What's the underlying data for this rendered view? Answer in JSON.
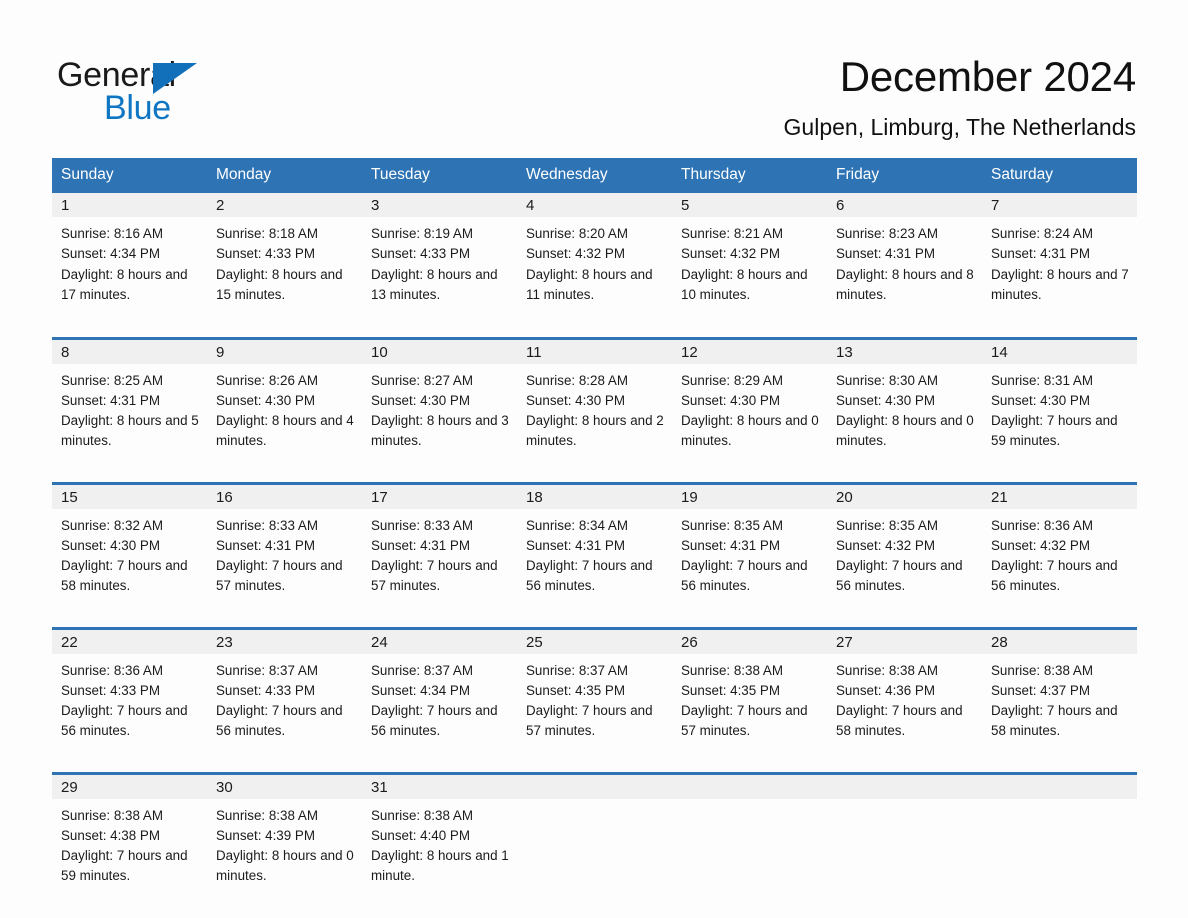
{
  "brand": {
    "name_part1": "General",
    "name_part2": "Blue",
    "triangle_color": "#1270ba",
    "blue_text_color": "#0f76c3"
  },
  "header": {
    "title": "December 2024",
    "subtitle": "Gulpen, Limburg, The Netherlands"
  },
  "theme": {
    "header_blue": "#2e74b5",
    "day_band_gray": "#f0f0f0",
    "page_background": "#fdfdfd",
    "text_color": "#1b1b1b"
  },
  "weekday_headers": [
    "Sunday",
    "Monday",
    "Tuesday",
    "Wednesday",
    "Thursday",
    "Friday",
    "Saturday"
  ],
  "weeks": [
    [
      {
        "day": "1",
        "sunrise": "Sunrise: 8:16 AM",
        "sunset": "Sunset: 4:34 PM",
        "daylight": "Daylight: 8 hours and 17 minutes."
      },
      {
        "day": "2",
        "sunrise": "Sunrise: 8:18 AM",
        "sunset": "Sunset: 4:33 PM",
        "daylight": "Daylight: 8 hours and 15 minutes."
      },
      {
        "day": "3",
        "sunrise": "Sunrise: 8:19 AM",
        "sunset": "Sunset: 4:33 PM",
        "daylight": "Daylight: 8 hours and 13 minutes."
      },
      {
        "day": "4",
        "sunrise": "Sunrise: 8:20 AM",
        "sunset": "Sunset: 4:32 PM",
        "daylight": "Daylight: 8 hours and 11 minutes."
      },
      {
        "day": "5",
        "sunrise": "Sunrise: 8:21 AM",
        "sunset": "Sunset: 4:32 PM",
        "daylight": "Daylight: 8 hours and 10 minutes."
      },
      {
        "day": "6",
        "sunrise": "Sunrise: 8:23 AM",
        "sunset": "Sunset: 4:31 PM",
        "daylight": "Daylight: 8 hours and 8 minutes."
      },
      {
        "day": "7",
        "sunrise": "Sunrise: 8:24 AM",
        "sunset": "Sunset: 4:31 PM",
        "daylight": "Daylight: 8 hours and 7 minutes."
      }
    ],
    [
      {
        "day": "8",
        "sunrise": "Sunrise: 8:25 AM",
        "sunset": "Sunset: 4:31 PM",
        "daylight": "Daylight: 8 hours and 5 minutes."
      },
      {
        "day": "9",
        "sunrise": "Sunrise: 8:26 AM",
        "sunset": "Sunset: 4:30 PM",
        "daylight": "Daylight: 8 hours and 4 minutes."
      },
      {
        "day": "10",
        "sunrise": "Sunrise: 8:27 AM",
        "sunset": "Sunset: 4:30 PM",
        "daylight": "Daylight: 8 hours and 3 minutes."
      },
      {
        "day": "11",
        "sunrise": "Sunrise: 8:28 AM",
        "sunset": "Sunset: 4:30 PM",
        "daylight": "Daylight: 8 hours and 2 minutes."
      },
      {
        "day": "12",
        "sunrise": "Sunrise: 8:29 AM",
        "sunset": "Sunset: 4:30 PM",
        "daylight": "Daylight: 8 hours and 0 minutes."
      },
      {
        "day": "13",
        "sunrise": "Sunrise: 8:30 AM",
        "sunset": "Sunset: 4:30 PM",
        "daylight": "Daylight: 8 hours and 0 minutes."
      },
      {
        "day": "14",
        "sunrise": "Sunrise: 8:31 AM",
        "sunset": "Sunset: 4:30 PM",
        "daylight": "Daylight: 7 hours and 59 minutes."
      }
    ],
    [
      {
        "day": "15",
        "sunrise": "Sunrise: 8:32 AM",
        "sunset": "Sunset: 4:30 PM",
        "daylight": "Daylight: 7 hours and 58 minutes."
      },
      {
        "day": "16",
        "sunrise": "Sunrise: 8:33 AM",
        "sunset": "Sunset: 4:31 PM",
        "daylight": "Daylight: 7 hours and 57 minutes."
      },
      {
        "day": "17",
        "sunrise": "Sunrise: 8:33 AM",
        "sunset": "Sunset: 4:31 PM",
        "daylight": "Daylight: 7 hours and 57 minutes."
      },
      {
        "day": "18",
        "sunrise": "Sunrise: 8:34 AM",
        "sunset": "Sunset: 4:31 PM",
        "daylight": "Daylight: 7 hours and 56 minutes."
      },
      {
        "day": "19",
        "sunrise": "Sunrise: 8:35 AM",
        "sunset": "Sunset: 4:31 PM",
        "daylight": "Daylight: 7 hours and 56 minutes."
      },
      {
        "day": "20",
        "sunrise": "Sunrise: 8:35 AM",
        "sunset": "Sunset: 4:32 PM",
        "daylight": "Daylight: 7 hours and 56 minutes."
      },
      {
        "day": "21",
        "sunrise": "Sunrise: 8:36 AM",
        "sunset": "Sunset: 4:32 PM",
        "daylight": "Daylight: 7 hours and 56 minutes."
      }
    ],
    [
      {
        "day": "22",
        "sunrise": "Sunrise: 8:36 AM",
        "sunset": "Sunset: 4:33 PM",
        "daylight": "Daylight: 7 hours and 56 minutes."
      },
      {
        "day": "23",
        "sunrise": "Sunrise: 8:37 AM",
        "sunset": "Sunset: 4:33 PM",
        "daylight": "Daylight: 7 hours and 56 minutes."
      },
      {
        "day": "24",
        "sunrise": "Sunrise: 8:37 AM",
        "sunset": "Sunset: 4:34 PM",
        "daylight": "Daylight: 7 hours and 56 minutes."
      },
      {
        "day": "25",
        "sunrise": "Sunrise: 8:37 AM",
        "sunset": "Sunset: 4:35 PM",
        "daylight": "Daylight: 7 hours and 57 minutes."
      },
      {
        "day": "26",
        "sunrise": "Sunrise: 8:38 AM",
        "sunset": "Sunset: 4:35 PM",
        "daylight": "Daylight: 7 hours and 57 minutes."
      },
      {
        "day": "27",
        "sunrise": "Sunrise: 8:38 AM",
        "sunset": "Sunset: 4:36 PM",
        "daylight": "Daylight: 7 hours and 58 minutes."
      },
      {
        "day": "28",
        "sunrise": "Sunrise: 8:38 AM",
        "sunset": "Sunset: 4:37 PM",
        "daylight": "Daylight: 7 hours and 58 minutes."
      }
    ],
    [
      {
        "day": "29",
        "sunrise": "Sunrise: 8:38 AM",
        "sunset": "Sunset: 4:38 PM",
        "daylight": "Daylight: 7 hours and 59 minutes."
      },
      {
        "day": "30",
        "sunrise": "Sunrise: 8:38 AM",
        "sunset": "Sunset: 4:39 PM",
        "daylight": "Daylight: 8 hours and 0 minutes."
      },
      {
        "day": "31",
        "sunrise": "Sunrise: 8:38 AM",
        "sunset": "Sunset: 4:40 PM",
        "daylight": "Daylight: 8 hours and 1 minute."
      },
      {
        "day": "",
        "sunrise": "",
        "sunset": "",
        "daylight": ""
      },
      {
        "day": "",
        "sunrise": "",
        "sunset": "",
        "daylight": ""
      },
      {
        "day": "",
        "sunrise": "",
        "sunset": "",
        "daylight": ""
      },
      {
        "day": "",
        "sunrise": "",
        "sunset": "",
        "daylight": ""
      }
    ]
  ]
}
